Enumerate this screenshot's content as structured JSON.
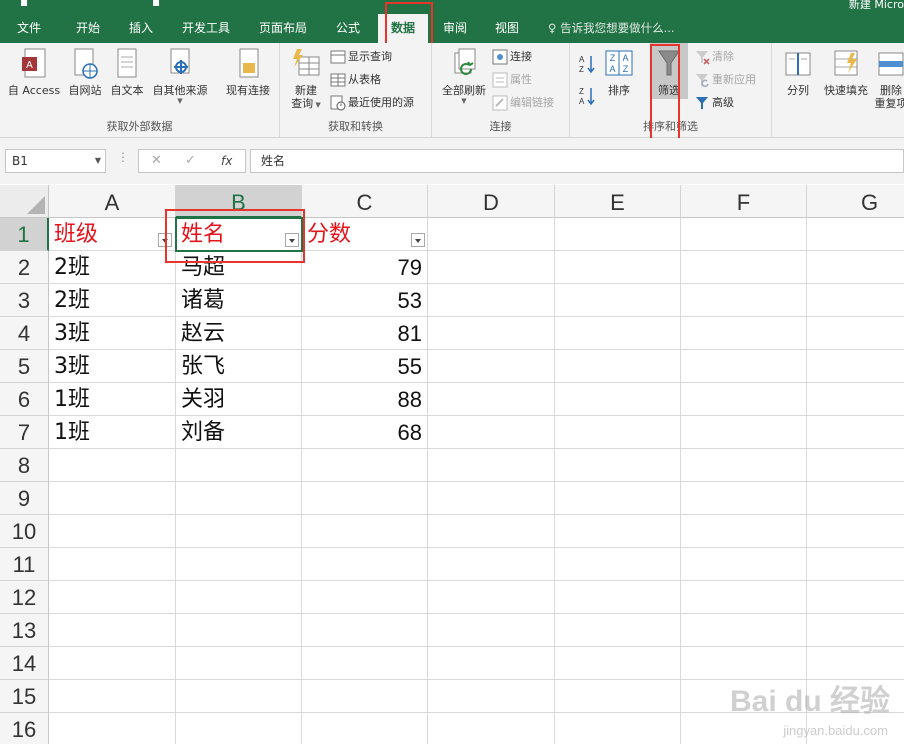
{
  "app": {
    "title_partial": "新建 Micro"
  },
  "tabs": [
    "文件",
    "开始",
    "插入",
    "开发工具",
    "页面布局",
    "公式",
    "数据",
    "审阅",
    "视图"
  ],
  "active_tab": "数据",
  "tell_me": "告诉我您想要做什么...",
  "ribbon": {
    "get_external": {
      "label": "获取外部数据",
      "access": "自 Access",
      "web": "自网站",
      "text": "自文本",
      "other": "自其他来源",
      "existing": "现有连接"
    },
    "get_transform": {
      "label": "获取和转换",
      "new_query_1": "新建",
      "new_query_2": "查询",
      "show_queries": "显示查询",
      "from_table": "从表格",
      "recent_sources": "最近使用的源"
    },
    "connections": {
      "label": "连接",
      "refresh_all": "全部刷新",
      "connections": "连接",
      "properties": "属性",
      "edit_links": "编辑链接"
    },
    "sort_filter": {
      "label": "排序和筛选",
      "sort": "排序",
      "filter": "筛选",
      "clear": "清除",
      "reapply": "重新应用",
      "advanced": "高级"
    },
    "data_tools": {
      "split": "分列",
      "flash_fill": "快速填充",
      "remove_dup_1": "删除",
      "remove_dup_2": "重复项"
    }
  },
  "formula_bar": {
    "name_box": "B1",
    "fx": "fx",
    "content": "姓名"
  },
  "sheet": {
    "columns": [
      "A",
      "B",
      "C",
      "D",
      "E",
      "F",
      "G"
    ],
    "rows": [
      "1",
      "2",
      "3",
      "4",
      "5",
      "6",
      "7",
      "8",
      "9",
      "10",
      "11",
      "12",
      "13",
      "14",
      "15",
      "16"
    ],
    "headers": {
      "A": "班级",
      "B": "姓名",
      "C": "分数"
    },
    "data": [
      {
        "A": "2班",
        "B": "马超",
        "C": "79"
      },
      {
        "A": "2班",
        "B": "诸葛",
        "C": "53"
      },
      {
        "A": "3班",
        "B": "赵云",
        "C": "81"
      },
      {
        "A": "3班",
        "B": "张飞",
        "C": "55"
      },
      {
        "A": "1班",
        "B": "关羽",
        "C": "88"
      },
      {
        "A": "1班",
        "B": "刘备",
        "C": "68"
      }
    ]
  },
  "watermark": {
    "main": "Bai du 经验",
    "sub": "jingyan.baidu.com"
  },
  "colors": {
    "excel_green": "#217346",
    "highlight_red": "#e8352c",
    "header_text": "#e3141c"
  }
}
